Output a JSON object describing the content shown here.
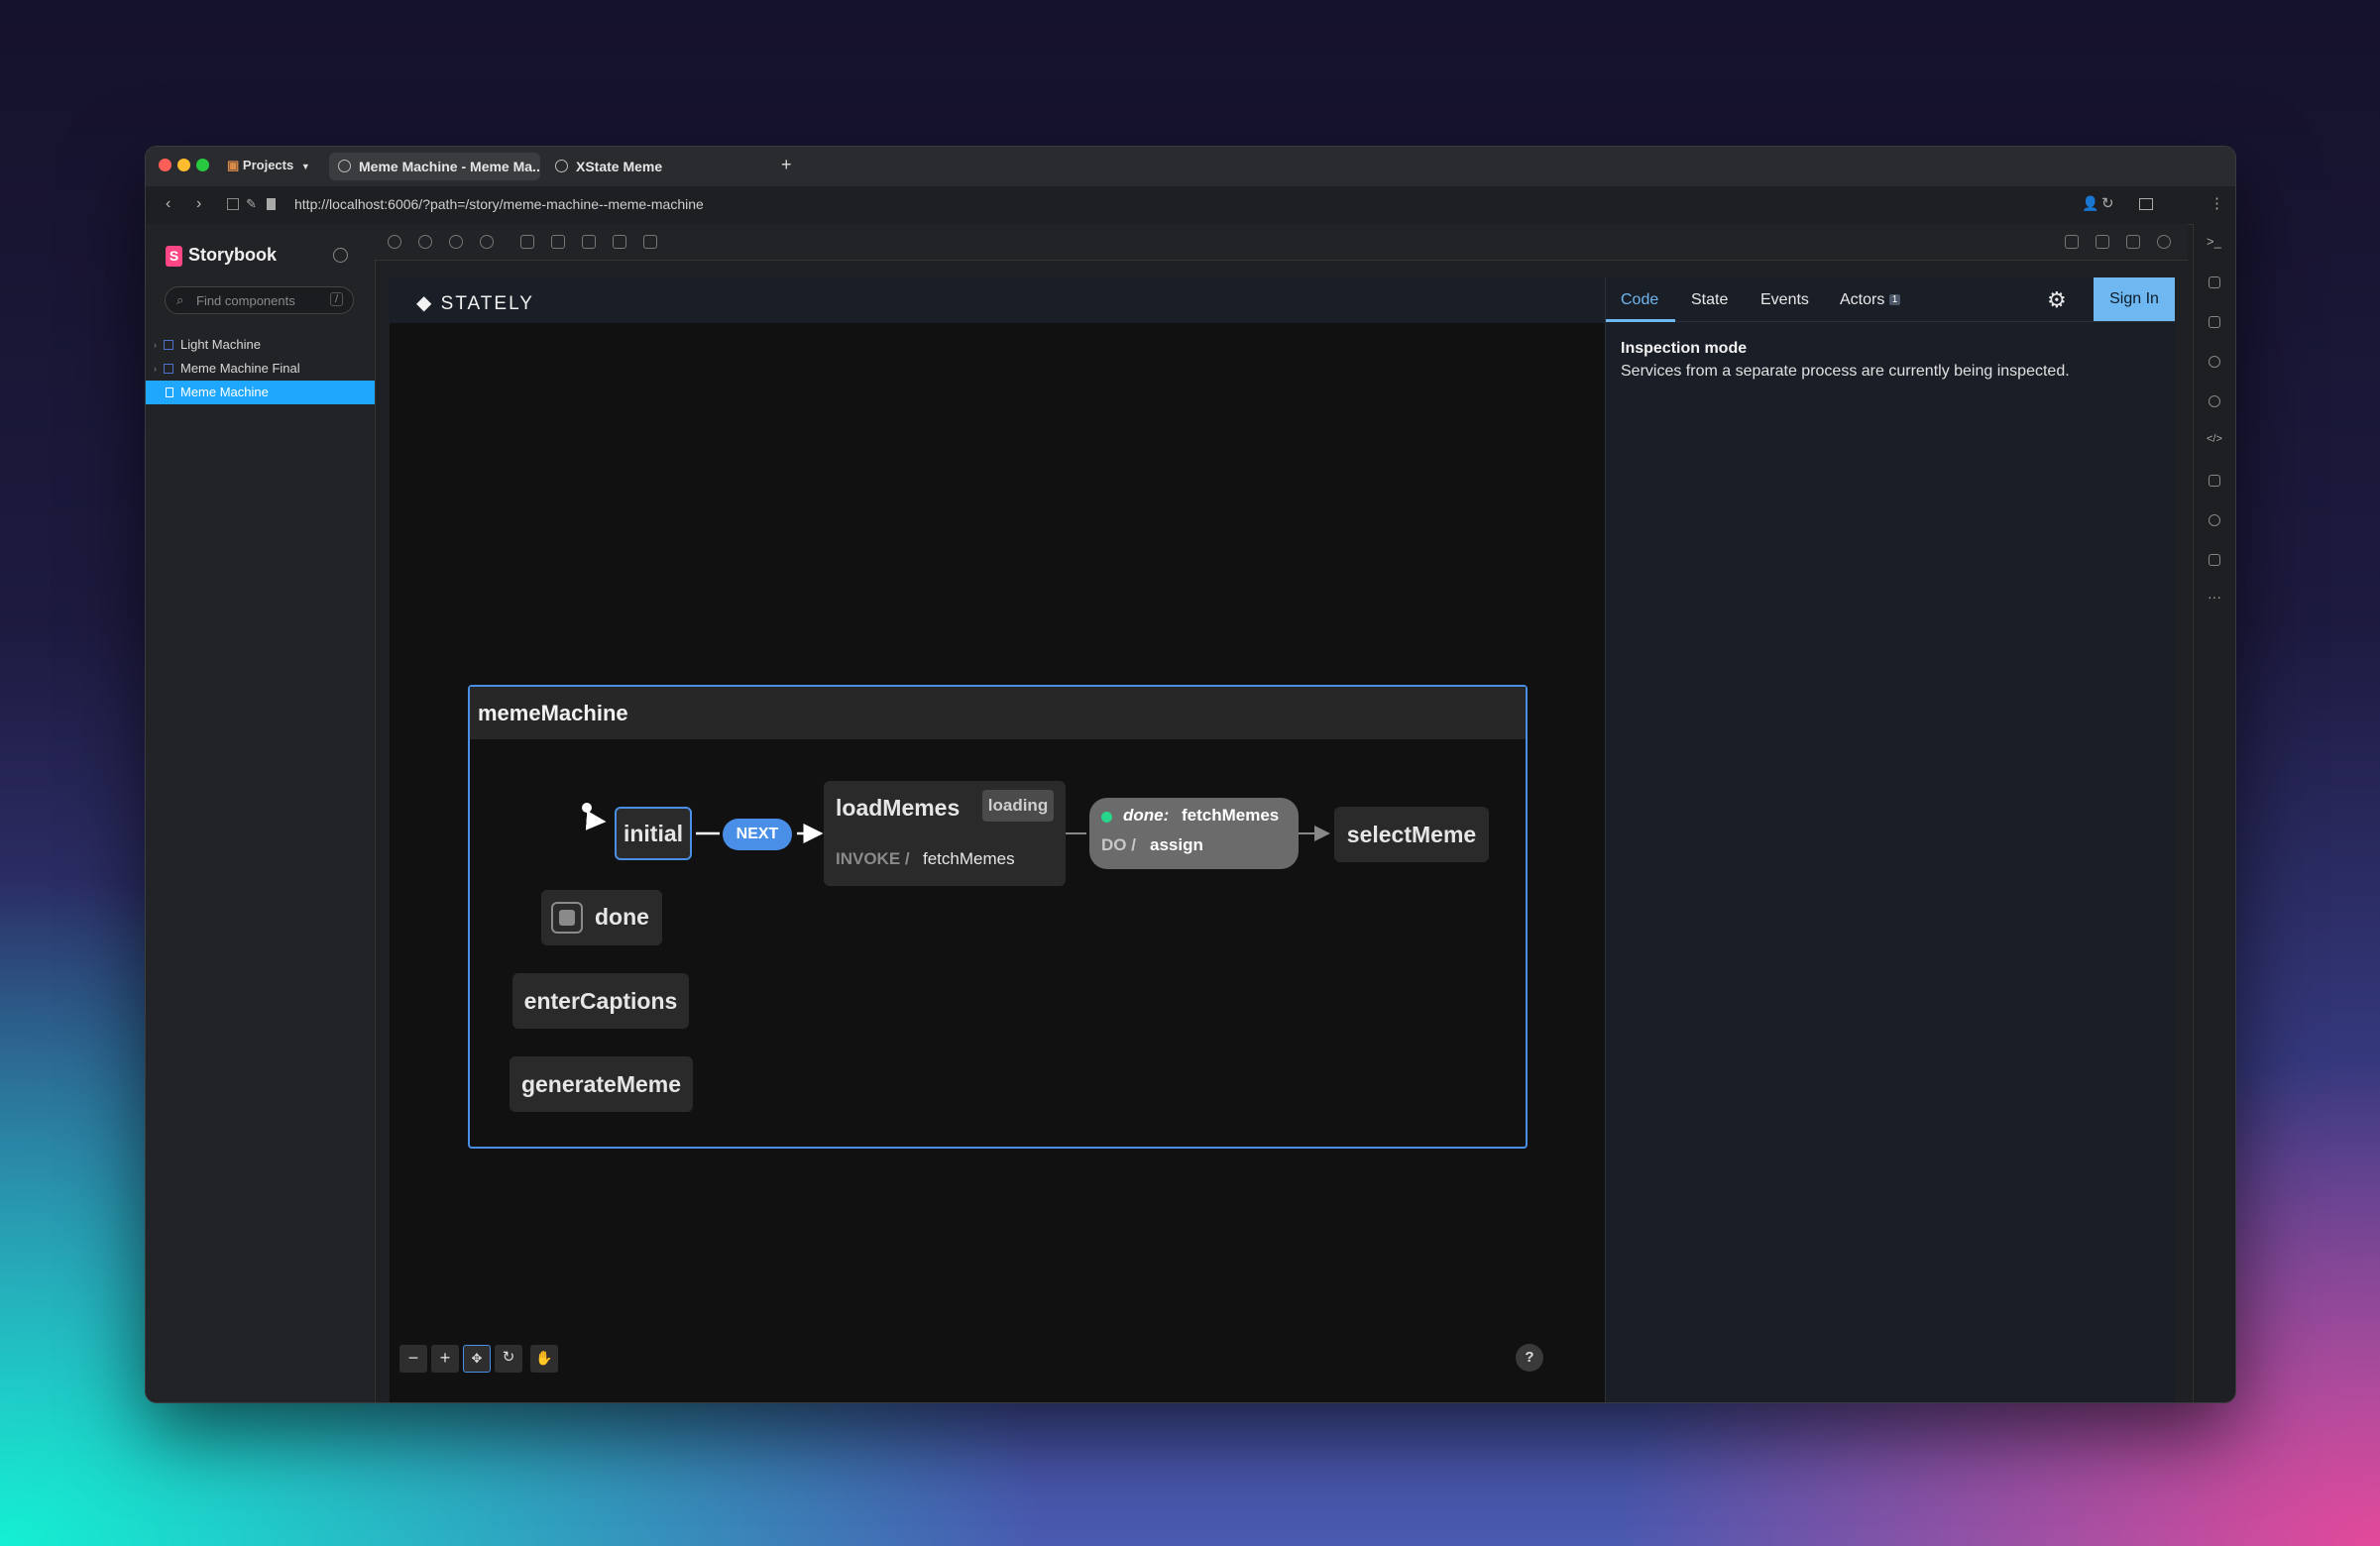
{
  "browser": {
    "projects_label": "Projects",
    "tabs": [
      {
        "title": "Meme Machine - Meme Ma..."
      },
      {
        "title": "XState Meme"
      }
    ],
    "new_tab": "+",
    "url": "http://localhost:6006/?path=/story/meme-machine--meme-machine"
  },
  "storybook": {
    "title": "Storybook",
    "search_placeholder": "Find components",
    "search_shortcut": "/",
    "items": [
      {
        "label": "Light Machine"
      },
      {
        "label": "Meme Machine Final"
      },
      {
        "label": "Meme Machine"
      }
    ]
  },
  "stately": {
    "logo": "STATELY",
    "tabs": {
      "code": "Code",
      "state": "State",
      "events": "Events",
      "actors": "Actors",
      "actors_count": "1"
    },
    "sign_in": "Sign In",
    "inspection_title": "Inspection mode",
    "inspection_text": "Services from a separate process are currently being inspected."
  },
  "machine": {
    "name": "memeMachine",
    "states": {
      "initial": "initial",
      "loadMemes": "loadMemes",
      "loading_tag": "loading",
      "invoke_label": "INVOKE /",
      "invoke_service": "fetchMemes",
      "selectMeme": "selectMeme",
      "done": "done",
      "enterCaptions": "enterCaptions",
      "generateMeme": "generateMeme"
    },
    "events": {
      "next": "NEXT",
      "done_label": "done:",
      "done_service": "fetchMemes",
      "do_label": "DO /",
      "do_action": "assign"
    }
  },
  "controls": {
    "zoom_out": "−",
    "zoom_in": "+",
    "help": "?"
  }
}
